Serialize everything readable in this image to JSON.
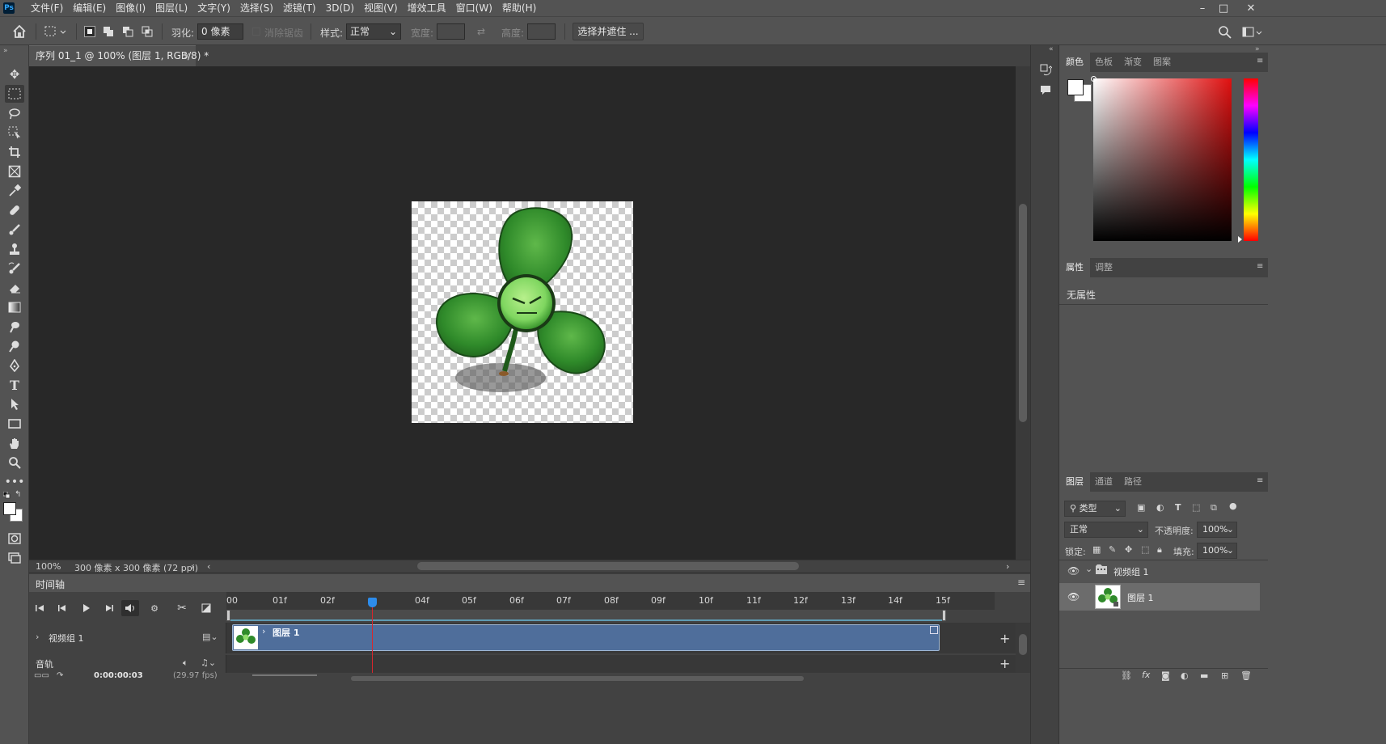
{
  "app": {
    "logo": "Ps"
  },
  "menu": [
    "文件(F)",
    "编辑(E)",
    "图像(I)",
    "图层(L)",
    "文字(Y)",
    "选择(S)",
    "滤镜(T)",
    "3D(D)",
    "视图(V)",
    "增效工具",
    "窗口(W)",
    "帮助(H)"
  ],
  "window_controls": {
    "minimize": "–",
    "maximize": "□",
    "close": "✕"
  },
  "options": {
    "feather_label": "羽化:",
    "feather_value": "0 像素",
    "antialias_label": "消除锯齿",
    "style_label": "样式:",
    "style_value": "正常",
    "width_label": "宽度:",
    "height_label": "高度:",
    "select_mask_button": "选择并遮住 ..."
  },
  "document": {
    "tab_title": "序列 01_1 @ 100% (图层 1, RGB/8) *",
    "tab_close": "×",
    "zoom": "100%",
    "doc_info": "300 像素 x 300 像素 (72 ppi)"
  },
  "timeline": {
    "title": "时间轴",
    "ruler_labels": [
      "00",
      "01f",
      "02f",
      "03f",
      "04f",
      "05f",
      "06f",
      "07f",
      "08f",
      "09f",
      "10f",
      "11f",
      "12f",
      "13f",
      "14f",
      "15f"
    ],
    "video_group_label": "视频组 1",
    "clip_label": "图层 1",
    "audio_label": "音轨",
    "timecode": "0:00:00:03",
    "fps": "(29.97 fps)",
    "playhead_frame": 3
  },
  "color_panel": {
    "tabs": [
      "颜色",
      "色板",
      "渐变",
      "图案"
    ],
    "active_tab": "颜色",
    "hue_color": "#e01010"
  },
  "properties_panel": {
    "tabs": [
      "属性",
      "调整"
    ],
    "active_tab": "属性",
    "content": "无属性"
  },
  "layers_panel": {
    "tabs": [
      "图层",
      "通道",
      "路径"
    ],
    "active_tab": "图层",
    "filter_label": "类型",
    "blend_mode": "正常",
    "opacity_label": "不透明度:",
    "opacity_value": "100%",
    "lock_label": "锁定:",
    "fill_label": "填充:",
    "fill_value": "100%",
    "layers": [
      {
        "name": "视频组 1",
        "type": "group",
        "visible": true
      },
      {
        "name": "图层 1",
        "type": "layer",
        "visible": true,
        "selected": true
      }
    ]
  }
}
